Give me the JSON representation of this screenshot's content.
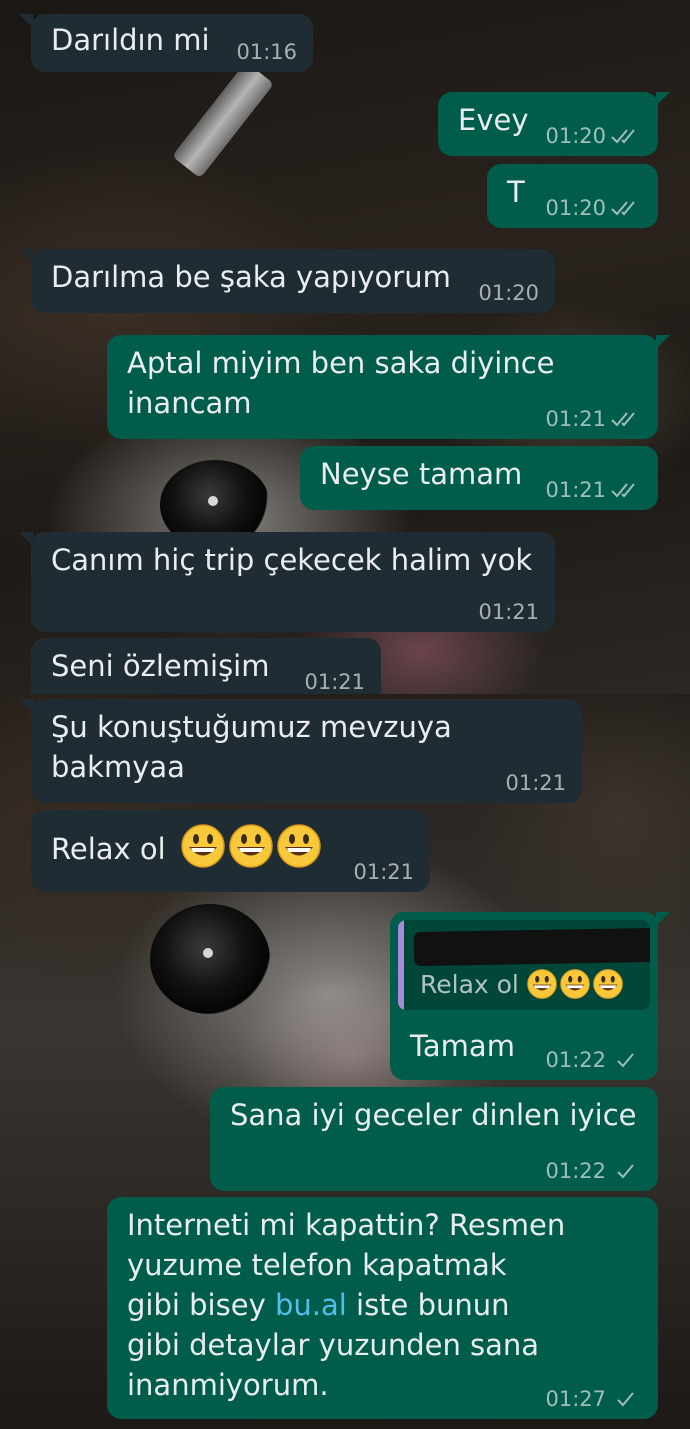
{
  "messages": [
    {
      "dir": "in",
      "text": "Darıldın mi",
      "time": "01:16"
    },
    {
      "dir": "out",
      "text": "Evey",
      "time": "01:20",
      "status": "read"
    },
    {
      "dir": "out",
      "text": "T",
      "time": "01:20",
      "status": "read"
    },
    {
      "dir": "in",
      "text": "Darılma be şaka yapıyorum",
      "time": "01:20"
    },
    {
      "dir": "out",
      "text_line1": "Aptal miyim ben saka diyince",
      "text_line2": "inancam",
      "time": "01:21",
      "status": "read"
    },
    {
      "dir": "out",
      "text": "Neyse tamam",
      "time": "01:21",
      "status": "read"
    },
    {
      "dir": "in",
      "text": "Canım hiç trip çekecek halim yok",
      "time": "01:21"
    },
    {
      "dir": "in",
      "text": "Seni özlemişim",
      "time": "01:21"
    },
    {
      "dir": "in",
      "text_line1": "Şu konuştuğumuz mevzuya",
      "text_line2": "bakmyaa",
      "time": "01:21"
    },
    {
      "dir": "in",
      "text": "Relax ol",
      "emoji": "grinning-face-emoji",
      "emoji_count": 3,
      "time": "01:21"
    },
    {
      "dir": "out",
      "quote_text": "Relax ol",
      "text": "Tamam",
      "time": "01:22",
      "status": "sent"
    },
    {
      "dir": "out",
      "text": "Sana iyi geceler dinlen iyice",
      "time": "01:22",
      "status": "sent"
    },
    {
      "dir": "out",
      "text_line1": "Interneti mi kapattin? Resmen",
      "text_line2": "yuzume telefon kapatmak",
      "text_line3_before": "gibi bisey ",
      "text_line3_link": "bu.al",
      "text_line3_after": " iste bunun",
      "text_line4": "gibi detaylar yuzunden sana",
      "text_line5": "inanmiyorum.",
      "time": "01:27",
      "status": "sent"
    }
  ],
  "colors": {
    "incoming": "#202c33",
    "outgoing": "#005c4b",
    "link": "#53bdeb",
    "quote_bar": "#a78bd8"
  }
}
